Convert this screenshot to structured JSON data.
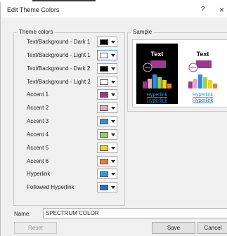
{
  "dialog": {
    "title": "Edit Theme Colors",
    "help": "?",
    "close": "×"
  },
  "theme_colors": {
    "label": "Theme colors",
    "rows": [
      {
        "label": "Text/Background - Dark 1",
        "color": "#000000"
      },
      {
        "label": "Text/Background - Light 1",
        "color": "#ffffff"
      },
      {
        "label": "Text/Background - Dark 2",
        "color": "#000000"
      },
      {
        "label": "Text/Background - Light 2",
        "color": "#ffffff"
      },
      {
        "label": "Accent 1",
        "color": "#9b3a8c"
      },
      {
        "label": "Accent 2",
        "color": "#e8a4c4"
      },
      {
        "label": "Accent 3",
        "color": "#2f8fd8"
      },
      {
        "label": "Accent 4",
        "color": "#9bcf5b"
      },
      {
        "label": "Accent 5",
        "color": "#f5d01c"
      },
      {
        "label": "Accent 6",
        "color": "#ee7d23"
      },
      {
        "label": "Hyperlink",
        "color": "#2e9be6"
      },
      {
        "label": "Followed Hyperlink",
        "color": "#1f6fc6"
      }
    ]
  },
  "sample": {
    "label": "Sample",
    "text": "Text",
    "hyperlink": "Hyperlink",
    "followed_hyperlink": "Hyperlink",
    "bar_colors": [
      "#9b3a8c",
      "#e8a4c4",
      "#2f8fd8",
      "#9bcf5b",
      "#f5d01c",
      "#ee7d23"
    ]
  },
  "name": {
    "label": "Name:",
    "value": "SPECTRUM COLOR"
  },
  "buttons": {
    "reset": "Reset",
    "save": "Save",
    "cancel": "Cancel"
  }
}
